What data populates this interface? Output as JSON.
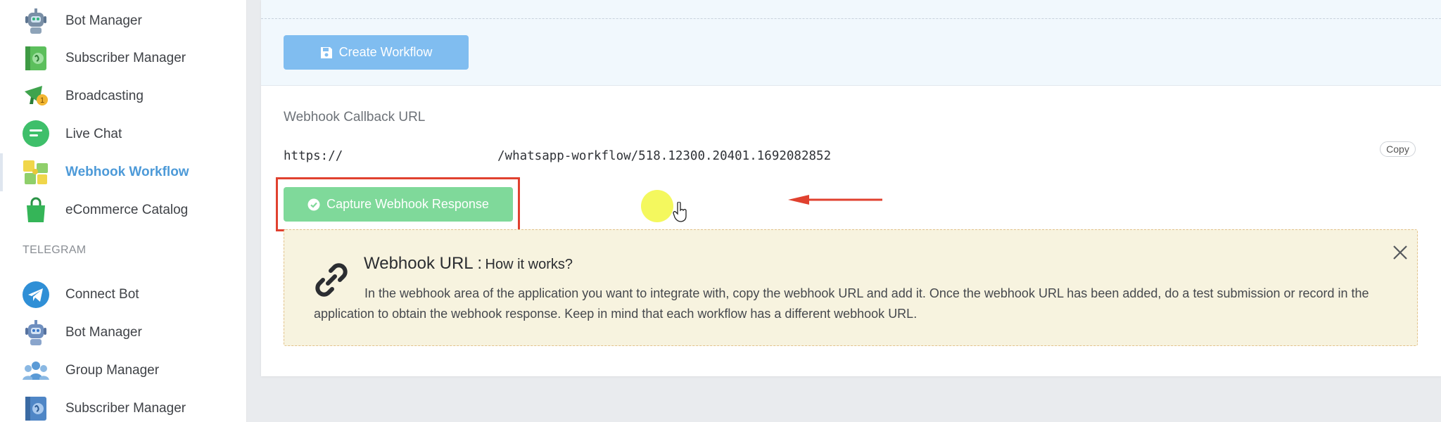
{
  "sidebar": {
    "items": [
      {
        "label": "Bot Manager",
        "icon": "bot-icon"
      },
      {
        "label": "Subscriber Manager",
        "icon": "subscriber-book-icon"
      },
      {
        "label": "Broadcasting",
        "icon": "megaphone-icon"
      },
      {
        "label": "Live Chat",
        "icon": "chat-bubble-icon"
      },
      {
        "label": "Webhook Workflow",
        "icon": "webhook-puzzle-icon",
        "active": true
      },
      {
        "label": "eCommerce Catalog",
        "icon": "shopping-bag-icon"
      }
    ],
    "section_telegram": "TELEGRAM",
    "telegram_items": [
      {
        "label": "Connect Bot",
        "icon": "telegram-plane-icon"
      },
      {
        "label": "Bot Manager",
        "icon": "bot-icon"
      },
      {
        "label": "Group Manager",
        "icon": "group-people-icon"
      },
      {
        "label": "Subscriber Manager",
        "icon": "subscriber-book-icon"
      }
    ]
  },
  "main": {
    "create_button": "Create Workflow",
    "webhook_label": "Webhook Callback URL",
    "url_prefix": "https://",
    "url_suffix": "/whatsapp-workflow/518.12300.20401.1692082852",
    "copy_button": "Copy",
    "capture_button": "Capture Webhook Response"
  },
  "info": {
    "title_main": "Webhook URL :",
    "title_sub": "How it works?",
    "text": "In the webhook area of the application you want to integrate with, copy the webhook URL and add it. Once the webhook URL has been added, do a test submission or record in the application to obtain the webhook response. Keep in mind that each workflow has a different webhook URL."
  },
  "colors": {
    "accent_blue": "#4d9ad8",
    "create_button_bg": "#80bdf0",
    "capture_button_bg": "#7fd99a",
    "annotation_red": "#e0412f",
    "info_bg": "#f7f3df"
  }
}
